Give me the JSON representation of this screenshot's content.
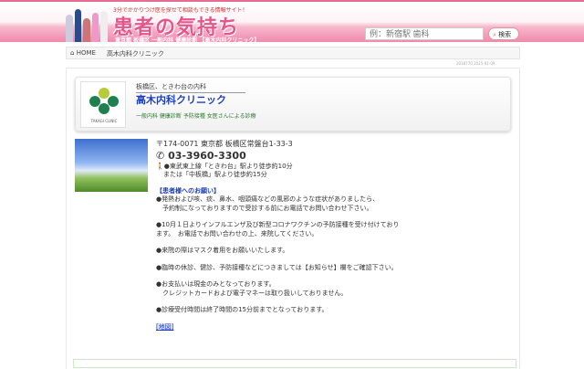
{
  "header": {
    "tagline": "3分でかかりつけ医を探せて相談もできる情報サイト！",
    "logo": "患者の気持ち",
    "subtitle": "東京都 板橋区 一般内科 健康診断 【高木内科クリニック】",
    "search_placeholder": "例：新宿駅 歯科",
    "search_button": "検索"
  },
  "breadcrumb": {
    "home": "HOME",
    "current": "高木内科クリニック"
  },
  "stamp": "2018770 2025-01-09",
  "clinic": {
    "area": "板橋区、ときわ台の内科",
    "name": "高木内科クリニック",
    "tags": "一般内科 健康診断 予防接種 女医さんによる診療",
    "logo_text": "TAKAGI CLINIC"
  },
  "info": {
    "address": "〒174-0071 東京都 板橋区常盤台1-33-3",
    "phone": "03-3960-3300",
    "access1": "●東武東上線「ときわ台」駅より徒歩約10分",
    "access2": "または「中板橋」駅より徒歩約15分",
    "notice_title": "【患者様へのお願い】",
    "notices": [
      "●発熱および咳、痰、鼻水、咽頭痛などの風邪のような症状がありましたら、",
      "　予約制になっておりますので受診する前にお電話でお問い合わせ下さい。",
      "●10月１日よりインフルエンザ及び新型コロナワクチンの予防接種を受け付けております。　お電話でお問い合わせの上、来院してください。",
      "●来院の際はマスク着用をお願いいたします。",
      "●臨時の休診、健診、予防接種などにつきましては【お知らせ】欄をご確認下さい。",
      "●お支払いは現金のみとなっております。",
      "　クレジットカードおよび電子マネーは取り扱いしておりません。",
      "●診療受付時間は終了時間の15分前までとなっております。"
    ],
    "map_link": "[地図]"
  }
}
